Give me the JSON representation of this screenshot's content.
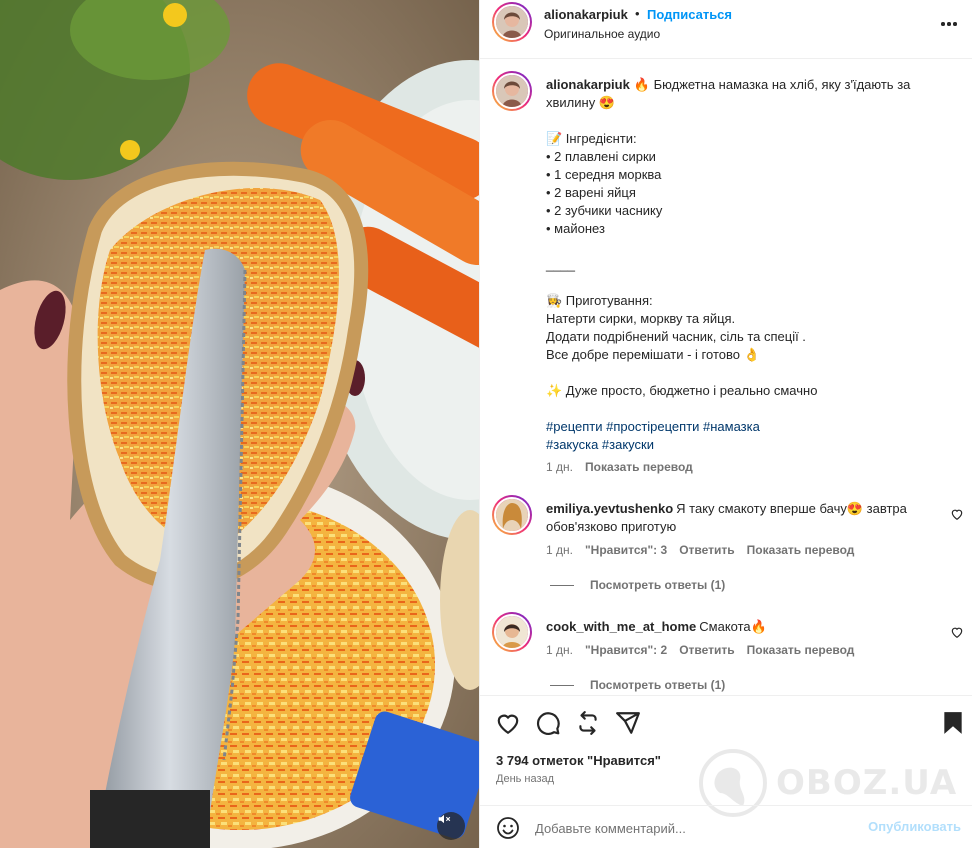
{
  "header": {
    "username": "alionakarpiuk",
    "separator": "•",
    "follow_label": "Подписаться",
    "audio": "Оригинальное аудио"
  },
  "caption": {
    "username": "alionakarpiuk",
    "lines": [
      "🔥 Бюджетна намазка на хліб, яку з'їдають за хвилину 😍",
      "",
      "📝 Інгредієнти:",
      "• 2 плавлені сирки",
      "• 1 середня морква",
      "• 2 варені яйця",
      "• 2 зубчики часнику",
      "• майонез",
      "",
      "____",
      "",
      "👩‍🍳 Приготування:",
      "Натерти сирки, моркву та яйця.",
      "Додати подрібнений часник, сіль та спеції .",
      "Все добре перемішати - і готово 👌",
      "",
      "✨ Дуже просто, бюджетно і реально смачно",
      ""
    ],
    "hashtags_line1": "#рецепти #простірецепти #намазка",
    "hashtags_line2": "#закуска #закуски",
    "time": "1 дн.",
    "translate": "Показать перевод"
  },
  "comments": [
    {
      "username": "emiliya.yevtushenko",
      "text": "Я таку смакоту вперше бачу😍 завтра обов'язково приготую",
      "time": "1 дн.",
      "likes": "\"Нравится\": 3",
      "reply": "Ответить",
      "translate": "Показать перевод",
      "replies": "Посмотреть ответы (1)"
    },
    {
      "username": "cook_with_me_at_home",
      "text": "Смакота🔥",
      "time": "1 дн.",
      "likes": "\"Нравится\": 2",
      "reply": "Ответить",
      "translate": "Показать перевод",
      "replies": "Посмотреть ответы (1)"
    }
  ],
  "actions": {
    "icons": [
      "heart-icon",
      "comment-icon",
      "repost-icon",
      "share-icon",
      "bookmark-icon"
    ],
    "likes": "3 794 отметок \"Нравится\"",
    "time_ago": "День назад"
  },
  "comment_box": {
    "placeholder": "Добавьте комментарий...",
    "publish_label": "Опубликовать"
  },
  "watermark": {
    "text": "OBOZ.UA"
  },
  "colors": {
    "link_blue": "#0095f6",
    "hashtag": "#00376b",
    "muted": "#737373",
    "publish_disabled": "#b2dffc"
  }
}
